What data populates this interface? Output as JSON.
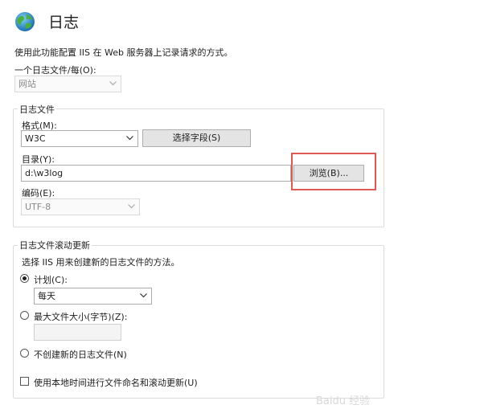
{
  "header": {
    "title": "日志",
    "icon": "globe-icon"
  },
  "description": "使用此功能配置 IIS 在 Web 服务器上记录请求的方式。",
  "one_log_per": {
    "label": "一个日志文件/每(O):",
    "value": "网站"
  },
  "log_file": {
    "group_label": "日志文件",
    "format_label": "格式(M):",
    "format_value": "W3C",
    "select_fields_button": "选择字段(S)",
    "directory_label": "目录(Y):",
    "directory_value": "d:\\w3log",
    "browse_button": "浏览(B)...",
    "encoding_label": "编码(E):",
    "encoding_value": "UTF-8"
  },
  "rollover": {
    "group_label": "日志文件滚动更新",
    "description": "选择 IIS 用来创建新的日志文件的方法。",
    "schedule_label": "计划(C):",
    "schedule_value": "每天",
    "max_size_label": "最大文件大小(字节)(Z):",
    "max_size_value": "",
    "no_new_label": "不创建新的日志文件(N)",
    "local_time_label": "使用本地时间进行文件命名和滚动更新(U)"
  },
  "watermark": "Baidu 经验",
  "colors": {
    "highlight": "#e05a55",
    "button_bg": "#e4e4e4",
    "border": "#acacac"
  }
}
